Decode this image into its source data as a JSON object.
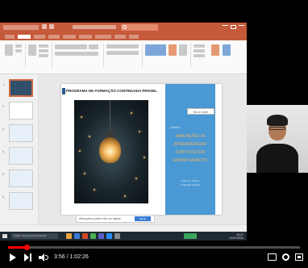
{
  "slide": {
    "header": "PROGRAMA DE FORMAÇÃO CONTINUADA PROSEL",
    "panel_small": "Cartilha",
    "panel_title_lines": [
      "AVALIAÇÃO DA",
      "APRENDIZAGEM",
      "COM FOCO EM",
      "ENSINO REMOTO"
    ],
    "panel_credit_lines": [
      "Profa. Dr. Fulano",
      "Instituição Federal"
    ]
  },
  "ppt": {
    "tooltip": "Novo slide",
    "notification": "Alterações podem não ser salvas",
    "notification_button": "Salvar",
    "taskbar_search": "Digite aqui para pesquisar",
    "clock_time": "15:27",
    "clock_date": "01/07/2020"
  },
  "player": {
    "time": "3:56 / 1:02:26",
    "progress_fraction": 0.063
  },
  "colors": {
    "ppt_accent": "#c55a3a",
    "slide_panel": "#4a99d4",
    "panel_title": "#f5b35a",
    "progress": "#ff0000"
  }
}
